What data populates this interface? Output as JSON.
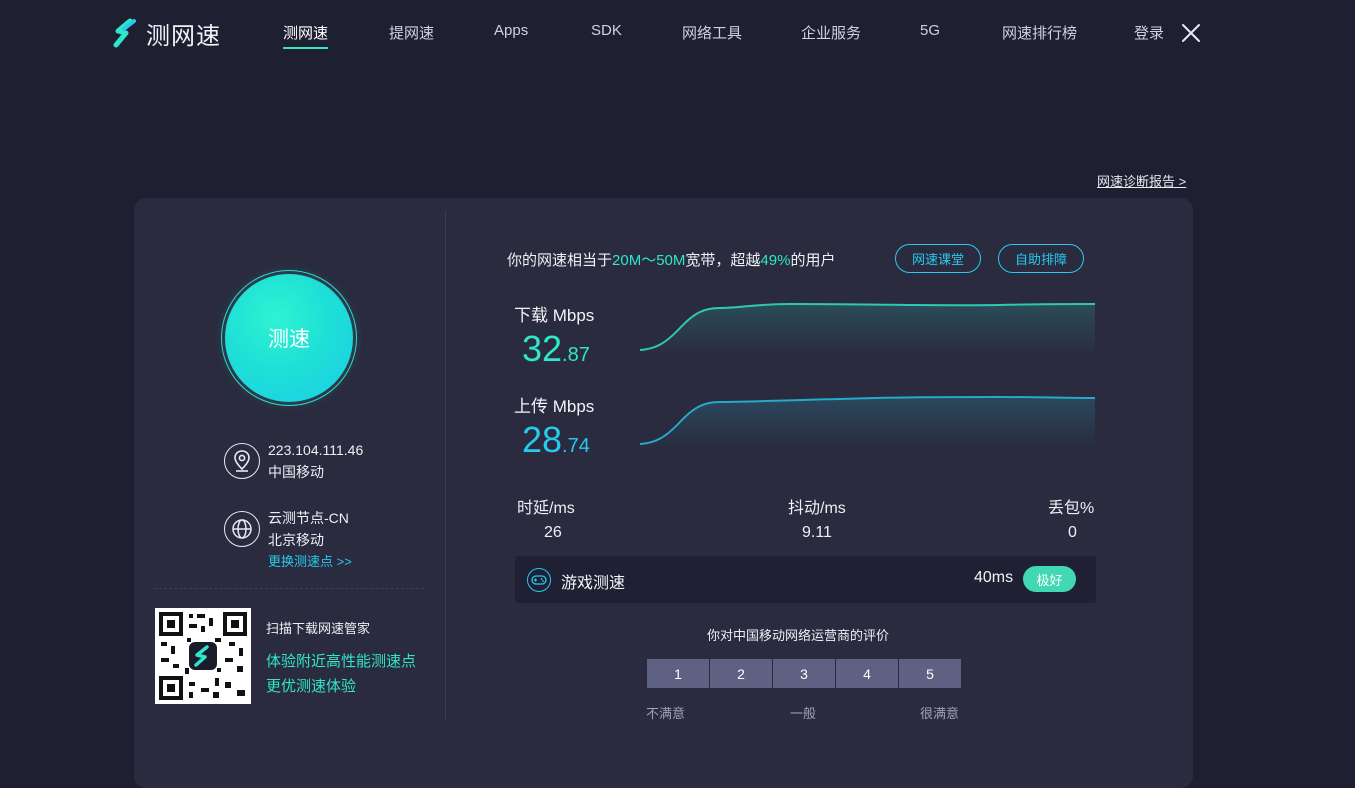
{
  "brand": {
    "name": "测网速",
    "accent": "#2ee6c8",
    "secondary": "#28c9ef"
  },
  "nav": {
    "items": [
      {
        "label": "测网速",
        "active": true
      },
      {
        "label": "提网速"
      },
      {
        "label": "Apps"
      },
      {
        "label": "SDK"
      },
      {
        "label": "网络工具"
      },
      {
        "label": "企业服务"
      },
      {
        "label": "5G"
      },
      {
        "label": "网速排行榜"
      },
      {
        "label": "登录"
      }
    ],
    "close_icon": "close-icon"
  },
  "report_link": "网速诊断报告 >",
  "left": {
    "speed_button": "测速",
    "ip": {
      "address": "223.104.111.46",
      "isp": "中国移动",
      "icon": "location-pin-icon"
    },
    "node": {
      "name": "云测节点-CN",
      "location": "北京移动",
      "change_link": "更换测速点 >>",
      "icon": "globe-icon"
    },
    "qr": {
      "title": "扫描下载网速管家",
      "line1": "体验附近高性能测速点",
      "line2": "更优测速体验"
    }
  },
  "right": {
    "summary": {
      "prefix": "你的网速相当于",
      "bandwidth": "20M～50M",
      "middle": "宽带，超越",
      "percent": "49%",
      "suffix": "的用户"
    },
    "buttons": {
      "course": "网速课堂",
      "troubleshoot": "自助排障"
    },
    "download": {
      "label": "下载 Mbps",
      "int": "32",
      "dec": ".87"
    },
    "upload": {
      "label": "上传 Mbps",
      "int": "28",
      "dec": ".74"
    },
    "stats": [
      {
        "label": "时延/ms",
        "value": "26"
      },
      {
        "label": "抖动/ms",
        "value": "9.11"
      },
      {
        "label": "丢包%",
        "value": "0"
      }
    ],
    "game": {
      "label": "游戏测速",
      "ms": "40ms",
      "badge": "极好",
      "icon": "gamepad-icon"
    },
    "rating": {
      "title": "你对中国移动网络运营商的评价",
      "options": [
        "1",
        "2",
        "3",
        "4",
        "5"
      ],
      "low": "不满意",
      "mid": "一般",
      "high": "很满意"
    }
  }
}
